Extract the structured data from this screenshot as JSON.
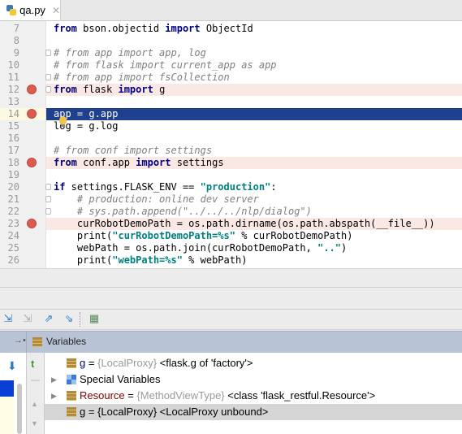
{
  "tab": {
    "filename": "qa.py",
    "close": "✕"
  },
  "colors": {
    "current_line": "#1f3f8f",
    "breakpoint": "#dc5a4f",
    "breakpoint_line": "#fae8e4",
    "header": "#b9c3d6"
  },
  "code_lines": [
    {
      "n": "7",
      "seg": [
        [
          "from",
          "kw"
        ],
        [
          " bson.objectid ",
          ""
        ],
        [
          "import",
          "kw"
        ],
        [
          " ObjectId",
          ""
        ]
      ]
    },
    {
      "n": "8",
      "seg": []
    },
    {
      "n": "9",
      "fold": true,
      "seg": [
        [
          "# from app import app, log",
          "cm"
        ]
      ]
    },
    {
      "n": "10",
      "seg": [
        [
          "# from flask import current_app as app",
          "cm"
        ]
      ]
    },
    {
      "n": "11",
      "fold": true,
      "seg": [
        [
          "# from app import fsCollection",
          "cm"
        ]
      ]
    },
    {
      "n": "12",
      "bp": true,
      "fold": true,
      "seg": [
        [
          "from",
          "kw"
        ],
        [
          " flask ",
          ""
        ],
        [
          "import",
          "kw"
        ],
        [
          " g",
          ""
        ]
      ]
    },
    {
      "n": "13",
      "seg": []
    },
    {
      "n": "14",
      "bp": true,
      "current": true,
      "seg": [
        [
          "app = g.app",
          ""
        ]
      ]
    },
    {
      "n": "15",
      "seg": [
        [
          "log = g.log",
          ""
        ]
      ]
    },
    {
      "n": "16",
      "seg": []
    },
    {
      "n": "17",
      "seg": [
        [
          "# from conf import settings",
          "cm"
        ]
      ]
    },
    {
      "n": "18",
      "bp": true,
      "seg": [
        [
          "from",
          "kw"
        ],
        [
          " conf.app ",
          ""
        ],
        [
          "import",
          "kw"
        ],
        [
          " settings",
          ""
        ]
      ]
    },
    {
      "n": "19",
      "seg": []
    },
    {
      "n": "20",
      "fold": true,
      "seg": [
        [
          "if",
          "kw"
        ],
        [
          " settings.FLASK_ENV == ",
          ""
        ],
        [
          "\"production\"",
          "st"
        ],
        [
          ":",
          ""
        ]
      ]
    },
    {
      "n": "21",
      "fold": true,
      "seg": [
        [
          "    # production: online dev server",
          "cm"
        ]
      ]
    },
    {
      "n": "22",
      "fold": true,
      "seg": [
        [
          "    # sys.path.append(\"../../../nlp/dialog\")",
          "cm"
        ]
      ]
    },
    {
      "n": "23",
      "bp": true,
      "seg": [
        [
          "    curRobotDemoPath = os.path.dirname(os.path.abspath(__file__))",
          ""
        ]
      ]
    },
    {
      "n": "24",
      "seg": [
        [
          "    print(",
          ""
        ],
        [
          "\"curRobotDemoPath=%s\"",
          "st"
        ],
        [
          " % curRobotDemoPath)",
          ""
        ]
      ]
    },
    {
      "n": "25",
      "seg": [
        [
          "    webPath = os.path.join(curRobotDemoPath, ",
          ""
        ],
        [
          "\"..\"",
          "st"
        ],
        [
          ")",
          ""
        ]
      ]
    },
    {
      "n": "26",
      "seg": [
        [
          "    print(",
          ""
        ],
        [
          "\"webPath=%s\"",
          "st"
        ],
        [
          " % webPath)",
          ""
        ]
      ]
    }
  ],
  "toolbar": {
    "icons": [
      "step-into-my-code-icon",
      "force-step-into-icon",
      "step-out-icon",
      "run-to-cursor-icon",
      "evaluate-expression-icon"
    ]
  },
  "variables": {
    "title": "Variables",
    "rows": [
      {
        "name": "g",
        "eq": " = ",
        "type": "{LocalProxy}",
        "value": " <flask.g of 'factory'>"
      },
      {
        "name": "Special Variables",
        "expandable": true
      },
      {
        "name": "Resource",
        "eq": " = ",
        "type": "{MethodViewType}",
        "value": " <class 'flask_restful.Resource'>",
        "expandable": true
      },
      {
        "name": "g",
        "eq": " = ",
        "type": "{LocalProxy}",
        "value": " <LocalProxy unbound>",
        "selected": true
      }
    ]
  }
}
